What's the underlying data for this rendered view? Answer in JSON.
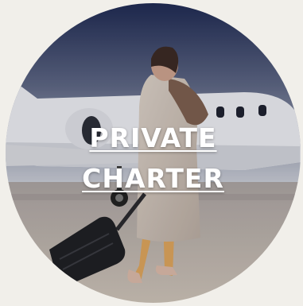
{
  "card": {
    "label_line1": "PRIVATE",
    "label_line2": "CHARTER"
  },
  "colors": {
    "page_background": "#f1efea",
    "label_text": "#ffffff",
    "sky_top": "#1f2a52",
    "sky_bottom": "#c9ccd5",
    "tarmac": "#b9afa7"
  }
}
